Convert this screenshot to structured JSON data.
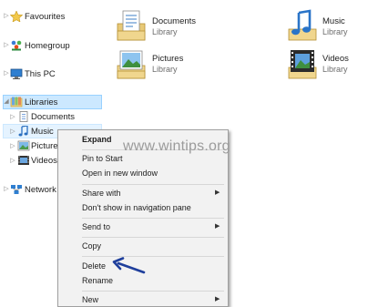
{
  "nav": {
    "favourites": "Favourites",
    "homegroup": "Homegroup",
    "this_pc": "This PC",
    "libraries": "Libraries",
    "documents": "Documents",
    "music": "Music",
    "pictures": "Pictures",
    "videos": "Videos",
    "network": "Network"
  },
  "content": {
    "tiles": [
      {
        "name": "Documents",
        "type": "Library",
        "icon": "documents-library-icon"
      },
      {
        "name": "Music",
        "type": "Library",
        "icon": "music-library-icon"
      },
      {
        "name": "Pictures",
        "type": "Library",
        "icon": "pictures-library-icon"
      },
      {
        "name": "Videos",
        "type": "Library",
        "icon": "videos-library-icon"
      }
    ]
  },
  "context_menu": {
    "expand": "Expand",
    "pin_to_start": "Pin to Start",
    "open_new_window": "Open in new window",
    "share_with": "Share with",
    "dont_show": "Don't show in navigation pane",
    "send_to": "Send to",
    "copy": "Copy",
    "delete": "Delete",
    "rename": "Rename",
    "new": "New"
  },
  "watermark": "www.wintips.org",
  "colors": {
    "selection": "#cce8ff",
    "annotation_arrow": "#1f3f9c"
  }
}
